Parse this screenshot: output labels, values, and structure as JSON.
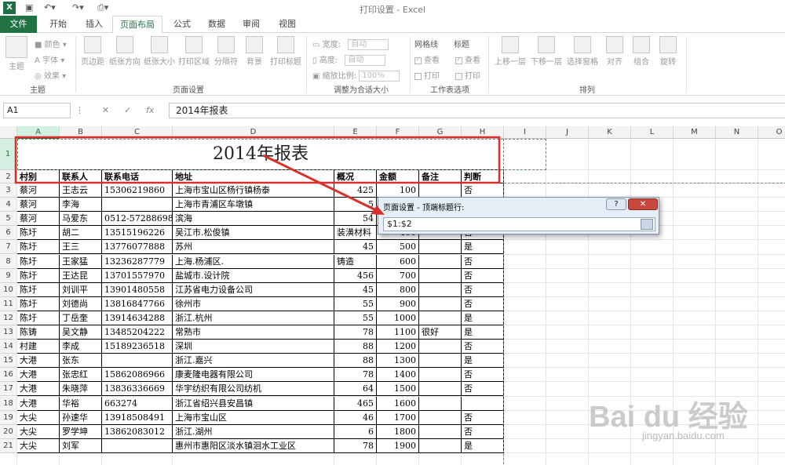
{
  "window": {
    "title": "打印设置 - Excel"
  },
  "tabs": [
    "文件",
    "开始",
    "插入",
    "页面布局",
    "公式",
    "数据",
    "审阅",
    "视图"
  ],
  "ribbon": {
    "theme_group": {
      "label": "主题",
      "theme_btn": "主题",
      "colors": "颜色",
      "fonts": "字体",
      "effects": "效果"
    },
    "page_setup": {
      "label": "页面设置",
      "margins": "页边距",
      "orientation": "纸张方向",
      "size": "纸张大小",
      "print_area": "打印区域",
      "breaks": "分隔符",
      "background": "背景",
      "print_titles": "打印标题"
    },
    "scale_group": {
      "label": "调整为合适大小",
      "width": "宽度:",
      "height": "高度:",
      "scale": "缩放比例:",
      "width_val": "自动",
      "height_val": "自动",
      "scale_val": "100%"
    },
    "sheet_options": {
      "label": "工作表选项",
      "gridlines": "网格线",
      "headings": "标题",
      "view": "查看",
      "print": "打印"
    },
    "arrange": {
      "label": "排列",
      "bring_forward": "上移一层",
      "send_backward": "下移一层",
      "selection_pane": "选择窗格",
      "align": "对齐",
      "group": "组合",
      "rotate": "旋转"
    }
  },
  "formula_bar": {
    "name_box": "A1",
    "formula": "2014年报表"
  },
  "columns": [
    "A",
    "B",
    "C",
    "D",
    "E",
    "F",
    "G",
    "H",
    "I",
    "J",
    "K",
    "L",
    "M",
    "N",
    "O"
  ],
  "sheet_title": "2014年报表",
  "table_headers": [
    "村别",
    "联系人",
    "联系电话",
    "地址",
    "概况",
    "金额",
    "备注",
    "判断"
  ],
  "rows": [
    [
      "3",
      "蔡河",
      "王志云",
      "15306219860",
      "上海市宝山区杨行镇杨泰",
      "425",
      "100",
      "",
      "否"
    ],
    [
      "4",
      "蔡河",
      "李海",
      "",
      "上海市青浦区车墩镇",
      "5",
      "",
      "",
      ""
    ],
    [
      "5",
      "蔡河",
      "马爱东",
      "0512-57288698",
      "滨海",
      "54",
      "",
      "",
      ""
    ],
    [
      "6",
      "陈圩",
      "胡二",
      "13515196226",
      "吴江市.松俊镇",
      "装潢材料",
      "400",
      "",
      "否"
    ],
    [
      "7",
      "陈圩",
      "王三",
      "13776077888",
      "苏州",
      "45",
      "500",
      "",
      "是"
    ],
    [
      "8",
      "陈圩",
      "王家猛",
      "13236287779",
      "上海.杨浦区.",
      "铸造",
      "600",
      "",
      "否"
    ],
    [
      "9",
      "陈圩",
      "王达昆",
      "13701557970",
      "盐城市.设计院",
      "456",
      "700",
      "",
      "否"
    ],
    [
      "10",
      "陈圩",
      "刘训平",
      "13901480558",
      "江苏省电力设备公司",
      "45",
      "800",
      "",
      "否"
    ],
    [
      "11",
      "陈圩",
      "刘德尚",
      "13816847766",
      "徐州市",
      "55",
      "900",
      "",
      "否"
    ],
    [
      "12",
      "陈圩",
      "丁岳奎",
      "13914634288",
      "浙江.杭州",
      "55",
      "1000",
      "",
      "是"
    ],
    [
      "13",
      "陈铸",
      "吴文静",
      "13485204222",
      "常熟市",
      "78",
      "1100",
      "很好",
      "是"
    ],
    [
      "14",
      "村建",
      "李成",
      "15189236518",
      "深圳",
      "88",
      "1200",
      "",
      "否"
    ],
    [
      "15",
      "大港",
      "张东",
      "",
      "浙江.嘉兴",
      "88",
      "1300",
      "",
      "是"
    ],
    [
      "16",
      "大港",
      "张忠红",
      "15862086966",
      "康麦隆电器有限公司",
      "78",
      "1400",
      "",
      "否"
    ],
    [
      "17",
      "大港",
      "朱晓萍",
      "13836336669",
      "华宇纺织有限公司纺机",
      "64",
      "1500",
      "",
      "否"
    ],
    [
      "18",
      "大港",
      "华裕",
      "663274",
      "浙江省绍兴县安昌镇",
      "465",
      "1600",
      "",
      ""
    ],
    [
      "19",
      "大尖",
      "孙速华",
      "13918508491",
      "上海市宝山区",
      "46",
      "1700",
      "",
      "否"
    ],
    [
      "20",
      "大尖",
      "罗学坤",
      "13862083012",
      "浙江.湖州",
      "6",
      "1800",
      "",
      "否"
    ],
    [
      "21",
      "大尖",
      "刘军",
      "",
      "惠州市惠阳区淡水镇洄水工业区",
      "78",
      "1900",
      "",
      "是"
    ]
  ],
  "dialog": {
    "title": "页面设置 - 顶端标题行:",
    "help": "?",
    "close": "✕",
    "value": "$1:$2"
  },
  "watermark": {
    "main": "Bai du 经验",
    "sub": "jingyan.baidu.com"
  },
  "colors": {
    "excel_green": "#217346",
    "highlight_red": "#d9302b"
  }
}
